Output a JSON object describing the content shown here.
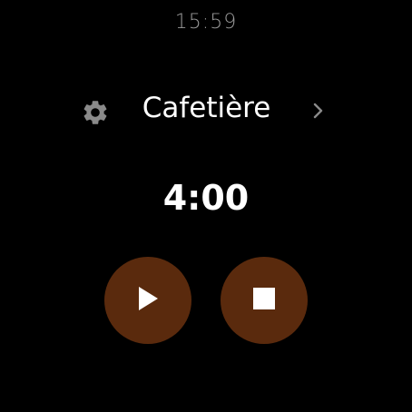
{
  "status_bar": {
    "time": "15:59"
  },
  "preset": {
    "name": "Cafetière",
    "settings_icon": "gear-icon",
    "next_icon": "chevron-right-icon"
  },
  "timer": {
    "remaining": "4:00"
  },
  "controls": {
    "play_icon": "play-icon",
    "stop_icon": "stop-icon",
    "button_color": "#5a2a0d"
  },
  "colors": {
    "background": "#000000",
    "text_primary": "#ffffff",
    "text_secondary": "#9a9a9a",
    "icon_muted": "#8a8a8a"
  }
}
